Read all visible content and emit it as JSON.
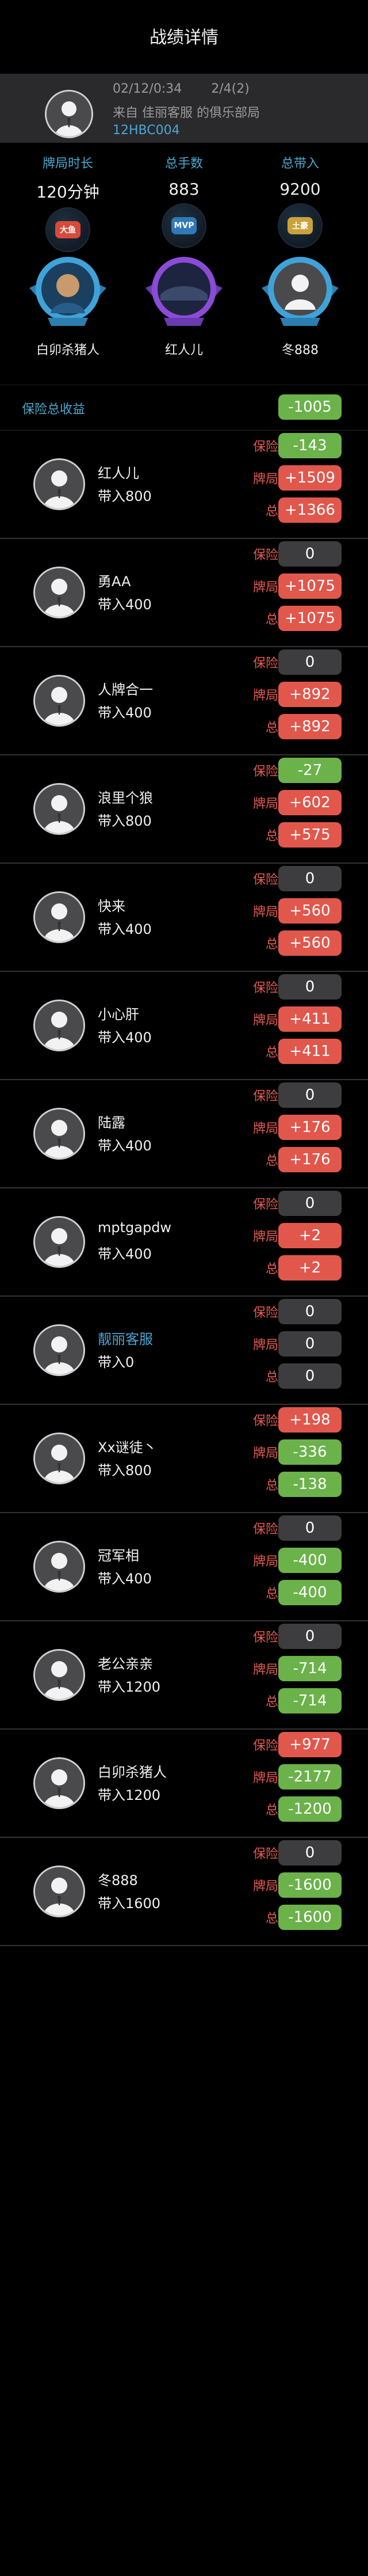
{
  "header": {
    "title": "战绩详情"
  },
  "game": {
    "date": "02/12/0:34",
    "round": "2/4(2)",
    "source": "来自 佳丽客服 的俱乐部局",
    "code": "12HBC004"
  },
  "stats": [
    {
      "label": "牌局时长",
      "value": "120分钟",
      "badge": "大鱼",
      "badge_color": "#d84a3c"
    },
    {
      "label": "总手数",
      "value": "883",
      "badge": "MVP",
      "badge_color": "#2f79b8"
    },
    {
      "label": "总带入",
      "value": "9200",
      "badge": "土豪",
      "badge_color": "#c9a23a"
    }
  ],
  "medals": [
    {
      "name": "白卯杀猪人",
      "ring_color": "#3fa3d9"
    },
    {
      "name": "红人儿",
      "ring_color": "#8c4bd6"
    },
    {
      "name": "冬888",
      "ring_color": "#3fa3d9"
    }
  ],
  "insurance_total": {
    "label": "保险总收益",
    "value": "-1005"
  },
  "row_labels": {
    "insurance": "保险收益",
    "hand": "牌局收益",
    "total": "总收益"
  },
  "players": [
    {
      "name": "红人儿",
      "buyin": "带入800",
      "ins": "-143",
      "hand": "+1509",
      "total": "+1366",
      "ins_c": "green",
      "hand_c": "red",
      "total_c": "red",
      "name_blue": false
    },
    {
      "name": "勇AA",
      "buyin": "带入400",
      "ins": "0",
      "hand": "+1075",
      "total": "+1075",
      "ins_c": "gray",
      "hand_c": "red",
      "total_c": "red",
      "name_blue": false
    },
    {
      "name": "人牌合一",
      "buyin": "带入400",
      "ins": "0",
      "hand": "+892",
      "total": "+892",
      "ins_c": "gray",
      "hand_c": "red",
      "total_c": "red",
      "name_blue": false
    },
    {
      "name": "浪里个狼",
      "buyin": "带入800",
      "ins": "-27",
      "hand": "+602",
      "total": "+575",
      "ins_c": "green",
      "hand_c": "red",
      "total_c": "red",
      "name_blue": false
    },
    {
      "name": "快来",
      "buyin": "带入400",
      "ins": "0",
      "hand": "+560",
      "total": "+560",
      "ins_c": "gray",
      "hand_c": "red",
      "total_c": "red",
      "name_blue": false
    },
    {
      "name": "小心肝",
      "buyin": "带入400",
      "ins": "0",
      "hand": "+411",
      "total": "+411",
      "ins_c": "gray",
      "hand_c": "red",
      "total_c": "red",
      "name_blue": false
    },
    {
      "name": "陆露",
      "buyin": "带入400",
      "ins": "0",
      "hand": "+176",
      "total": "+176",
      "ins_c": "gray",
      "hand_c": "red",
      "total_c": "red",
      "name_blue": false
    },
    {
      "name": "mptgapdw",
      "buyin": "带入400",
      "ins": "0",
      "hand": "+2",
      "total": "+2",
      "ins_c": "gray",
      "hand_c": "red",
      "total_c": "red",
      "name_blue": false
    },
    {
      "name": "靓丽客服",
      "buyin": "带入0",
      "ins": "0",
      "hand": "0",
      "total": "0",
      "ins_c": "gray",
      "hand_c": "gray",
      "total_c": "gray",
      "name_blue": true
    },
    {
      "name": "Xx谜徒丶",
      "buyin": "带入800",
      "ins": "+198",
      "hand": "-336",
      "total": "-138",
      "ins_c": "red",
      "hand_c": "green",
      "total_c": "green",
      "name_blue": false
    },
    {
      "name": "冠军相",
      "buyin": "带入400",
      "ins": "0",
      "hand": "-400",
      "total": "-400",
      "ins_c": "gray",
      "hand_c": "green",
      "total_c": "green",
      "name_blue": false
    },
    {
      "name": "老公亲亲",
      "buyin": "带入1200",
      "ins": "0",
      "hand": "-714",
      "total": "-714",
      "ins_c": "gray",
      "hand_c": "green",
      "total_c": "green",
      "name_blue": false
    },
    {
      "name": "白卯杀猪人",
      "buyin": "带入1200",
      "ins": "+977",
      "hand": "-2177",
      "total": "-1200",
      "ins_c": "red",
      "hand_c": "green",
      "total_c": "green",
      "name_blue": false
    },
    {
      "name": "冬888",
      "buyin": "带入1600",
      "ins": "0",
      "hand": "-1600",
      "total": "-1600",
      "ins_c": "gray",
      "hand_c": "green",
      "total_c": "green",
      "name_blue": false
    }
  ]
}
